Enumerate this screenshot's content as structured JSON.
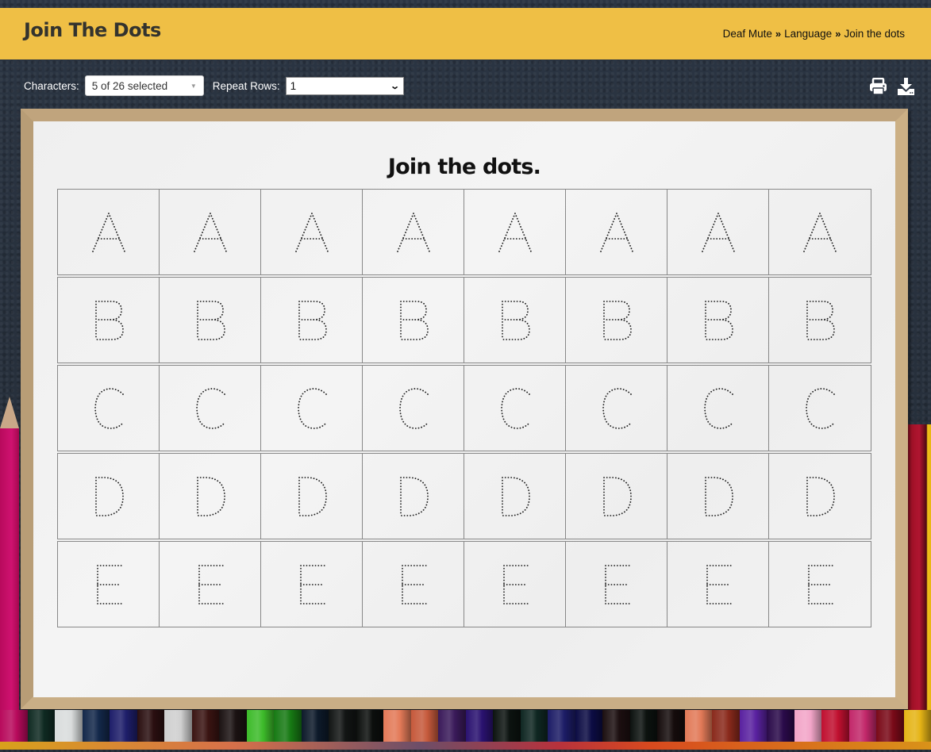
{
  "header": {
    "title": "Join The Dots",
    "breadcrumb": [
      {
        "label": "Deaf Mute"
      },
      {
        "label": "Language"
      },
      {
        "label": "Join the dots"
      }
    ],
    "breadcrumb_separator": "»",
    "accent_color": "#efbf45"
  },
  "controls": {
    "characters_label": "Characters:",
    "characters_value": "5 of 26 selected",
    "repeat_rows_label": "Repeat Rows:",
    "repeat_rows_value": "1"
  },
  "tools": [
    {
      "name": "print",
      "icon": "print-icon"
    },
    {
      "name": "download",
      "icon": "download-icon"
    }
  ],
  "worksheet": {
    "title": "Join the dots.",
    "columns": 8,
    "rows": [
      {
        "letter": "A"
      },
      {
        "letter": "B"
      },
      {
        "letter": "C"
      },
      {
        "letter": "D"
      },
      {
        "letter": "E"
      }
    ]
  }
}
